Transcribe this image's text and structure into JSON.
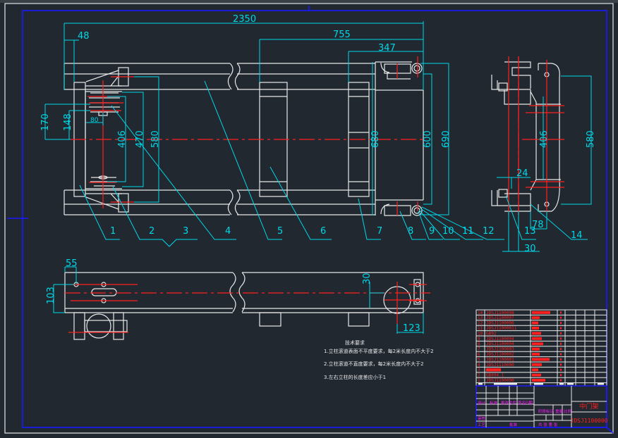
{
  "colors": {
    "background": "#212830",
    "outline": "#e8e8e8",
    "dimension": "#00d8e8",
    "centerline": "#ff2020",
    "frame": "#1a1aff",
    "title_text": "#ff20ff"
  },
  "dimensions": {
    "overall_length": "2350",
    "d48": "48",
    "d755": "755",
    "d347": "347",
    "d170": "170",
    "d148": "148",
    "d80": "80",
    "d406": "406",
    "d470": "470",
    "d580": "580",
    "d680": "680",
    "d600": "600",
    "d690": "690",
    "side_406": "406",
    "side_580": "580",
    "d24": "24",
    "d78": "78",
    "d30": "30",
    "d55": "55",
    "d103": "103",
    "d30b": "30",
    "d123": "123"
  },
  "part_labels": [
    "1",
    "2",
    "3",
    "4",
    "5",
    "6",
    "7",
    "8",
    "9",
    "10",
    "11",
    "12",
    "13",
    "14"
  ],
  "technical_requirements": {
    "title": "技术要求",
    "items": [
      "1.立柱滚道表面不平度要求，每2米长度内不大于2",
      "2.立柱滚道不直度要求，每2米长度内不大于2",
      "3.左右立柱的长度差应小于1"
    ]
  },
  "bom": {
    "rows": [
      {
        "no": "14",
        "code": "JDSJ1100008"
      },
      {
        "no": "13",
        "code": "JDSJ1100007"
      },
      {
        "no": "12",
        "code": "JDSJ1100006"
      },
      {
        "no": "11",
        "code": "JDSJ11000011"
      },
      {
        "no": "10",
        "code": "GB92"
      },
      {
        "no": "9",
        "code": "JDSJ1100004"
      },
      {
        "no": "8",
        "code": "JDSJ1100004"
      },
      {
        "no": "7",
        "code": "JDSJ1100003"
      },
      {
        "no": "6",
        "code": "JDSJ1100002"
      },
      {
        "no": "5",
        "code": "JDSJ1100001"
      },
      {
        "no": "4",
        "code": "JDSJ1110000"
      },
      {
        "no": "3",
        "code": ""
      },
      {
        "no": "2",
        "code": "GB894.1"
      },
      {
        "no": "1",
        "code": "JDSJ1100000"
      }
    ]
  },
  "title_block": {
    "drawing_title": "中门架",
    "drawing_number": "JDSJ1100000"
  }
}
